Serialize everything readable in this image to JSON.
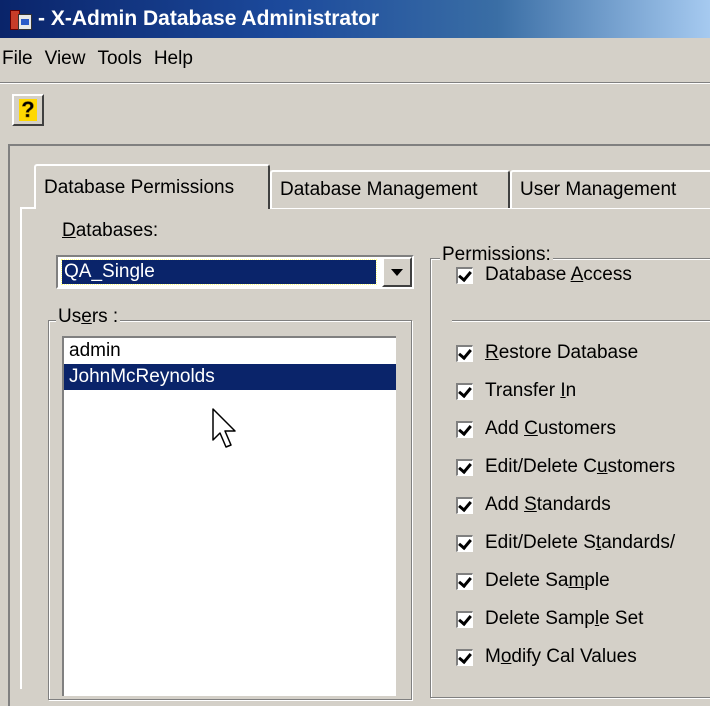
{
  "window": {
    "title": "- X-Admin Database Administrator"
  },
  "menu": [
    "File",
    "View",
    "Tools",
    "Help"
  ],
  "toolbar": {
    "help_glyph": "?"
  },
  "tabs": [
    {
      "label": "Database Permissions",
      "active": true
    },
    {
      "label": "Database Management",
      "active": false
    },
    {
      "label": "User Management",
      "active": false
    }
  ],
  "databases": {
    "label_accel": "D",
    "label_rest": "atabases:",
    "selected": "QA_Single"
  },
  "users": {
    "caption_pre": "Us",
    "caption_accel": "e",
    "caption_post": "rs :",
    "items": [
      {
        "label": "admin",
        "selected": false
      },
      {
        "label": "JohnMcReynolds",
        "selected": true
      }
    ]
  },
  "permissions": {
    "caption": "Permissions:",
    "access": {
      "pre": "Database ",
      "accel": "A",
      "post": "ccess",
      "checked": true
    },
    "items": [
      {
        "pre": "",
        "accel": "R",
        "post": "estore Database",
        "checked": true
      },
      {
        "pre": "Transfer ",
        "accel": "I",
        "post": "n",
        "checked": true
      },
      {
        "pre": "Add ",
        "accel": "C",
        "post": "ustomers",
        "checked": true
      },
      {
        "pre": "Edit/Delete C",
        "accel": "u",
        "post": "stomers",
        "checked": true
      },
      {
        "pre": "Add ",
        "accel": "S",
        "post": "tandards",
        "checked": true
      },
      {
        "pre": "Edit/Delete S",
        "accel": "t",
        "post": "andards/",
        "checked": true
      },
      {
        "pre": "Delete Sa",
        "accel": "m",
        "post": "ple",
        "checked": true
      },
      {
        "pre": "Delete Samp",
        "accel": "l",
        "post": "e Set",
        "checked": true
      },
      {
        "pre": "M",
        "accel": "o",
        "post": "dify Cal Values",
        "checked": true
      }
    ]
  },
  "colors": {
    "title_bar": "#0a246a",
    "selection": "#0a246a",
    "face": "#d4d0c8"
  }
}
